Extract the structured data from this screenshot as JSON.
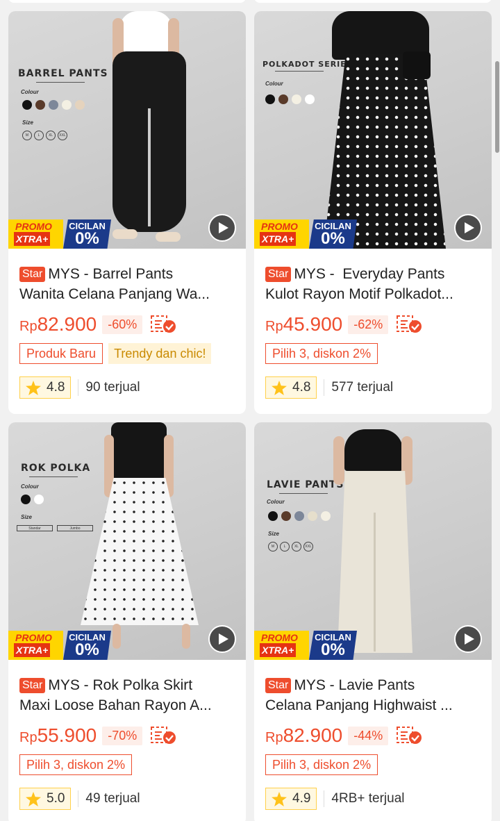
{
  "products": [
    {
      "badge": "Star",
      "title_line1": "MYS - Barrel Pants",
      "title_line2": "Wanita Celana Panjang Wa...",
      "currency": "Rp",
      "price": "82.900",
      "discount": "-60%",
      "tags": [
        {
          "label": "Produk Baru",
          "style": "red"
        },
        {
          "label": "Trendy dan chic!",
          "style": "yellow"
        }
      ],
      "rating": "4.8",
      "sold": "90 terjual",
      "image": {
        "series": "BARREL PANTS",
        "colour_label": "Colour",
        "size_label": "Size",
        "swatches": [
          "#111111",
          "#5a3b2a",
          "#7d8799",
          "#f4f0e3",
          "#e5d3bd"
        ],
        "sizes": [
          "M",
          "L",
          "XL",
          "XXL"
        ],
        "garment_color": "#1a1a1a"
      }
    },
    {
      "badge": "Star",
      "title_line1": "MYS -  Everyday Pants",
      "title_line2": "Kulot Rayon Motif Polkadot...",
      "currency": "Rp",
      "price": "45.900",
      "discount": "-62%",
      "tags": [
        {
          "label": "Pilih 3, diskon 2%",
          "style": "red"
        }
      ],
      "rating": "4.8",
      "sold": "577 terjual",
      "image": {
        "series": "POLKADOT SERIES",
        "colour_label": "Colour",
        "swatches": [
          "#111111",
          "#5a3b2a",
          "#f4f0e3",
          "#ffffff"
        ],
        "garment_color": "#161616"
      }
    },
    {
      "badge": "Star",
      "title_line1": "MYS - Rok Polka Skirt",
      "title_line2": "Maxi Loose Bahan Rayon A...",
      "currency": "Rp",
      "price": "55.900",
      "discount": "-70%",
      "tags": [
        {
          "label": "Pilih 3, diskon 2%",
          "style": "red"
        }
      ],
      "rating": "5.0",
      "sold": "49 terjual",
      "image": {
        "series": "ROK POLKA",
        "colour_label": "Colour",
        "size_label": "Size",
        "swatches": [
          "#111111",
          "#ffffff"
        ],
        "size_boxes": [
          "Standar",
          "Jumbo"
        ],
        "garment_color": "#f7f7f7"
      }
    },
    {
      "badge": "Star",
      "title_line1": "MYS - Lavie Pants",
      "title_line2": "Celana Panjang Highwaist ...",
      "currency": "Rp",
      "price": "82.900",
      "discount": "-44%",
      "tags": [
        {
          "label": "Pilih 3, diskon 2%",
          "style": "red"
        }
      ],
      "rating": "4.9",
      "sold": "4RB+ terjual",
      "image": {
        "series": "LAVIE PANTS",
        "colour_label": "Colour",
        "size_label": "Size",
        "swatches": [
          "#111111",
          "#5a3b2a",
          "#7d8799",
          "#e6dfcc",
          "#f4f0e3"
        ],
        "sizes": [
          "M",
          "L",
          "XL",
          "XXL"
        ],
        "garment_color": "#e9e4d8"
      }
    }
  ],
  "promo_badge": {
    "line1": "PROMO",
    "line2": "XTRA+",
    "installment_label": "CICILAN",
    "installment_value": "0%"
  },
  "colors": {
    "accent": "#ee4d2d",
    "promo_yellow": "#ffd500",
    "promo_blue": "#1b3a8a",
    "rating_star": "#ffc21a"
  },
  "icons": {
    "video": "play-icon",
    "cod": "cod-check-icon",
    "rating": "star-icon"
  }
}
